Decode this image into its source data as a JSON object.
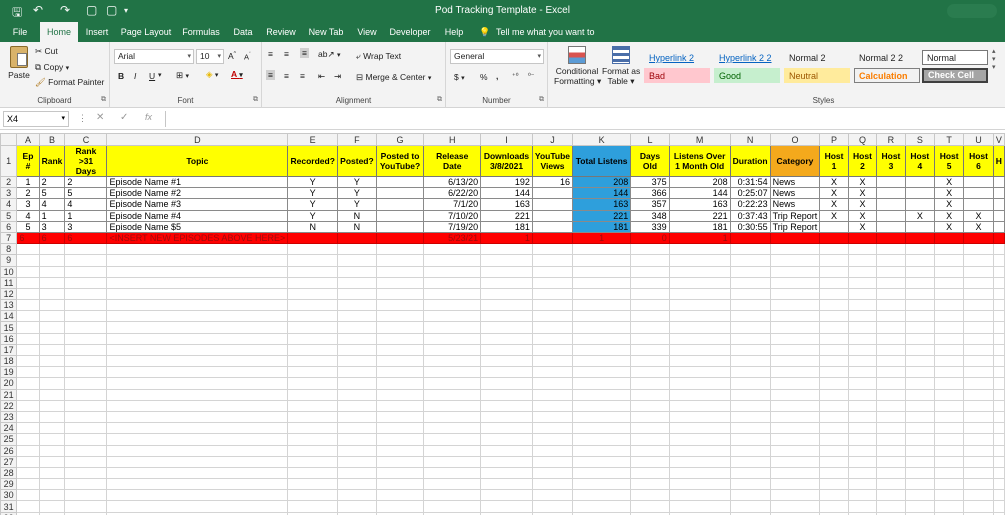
{
  "window": {
    "title": "Pod Tracking Template  -  Excel"
  },
  "tabs": [
    "File",
    "Home",
    "Insert",
    "Page Layout",
    "Formulas",
    "Data",
    "Review",
    "New Tab",
    "View",
    "Developer",
    "Help"
  ],
  "tell_me": "Tell me what you want to do",
  "ribbon": {
    "clipboard": {
      "paste": "Paste",
      "cut": "Cut",
      "copy": "Copy",
      "format_painter": "Format Painter",
      "label": "Clipboard"
    },
    "font": {
      "name": "Arial",
      "size": "10",
      "label": "Font",
      "bold": "B",
      "italic": "I",
      "underline": "U"
    },
    "alignment": {
      "wrap": "Wrap Text",
      "merge": "Merge & Center",
      "label": "Alignment"
    },
    "number": {
      "format": "General",
      "label": "Number",
      "currency": "$",
      "percent": "%",
      "comma": ","
    },
    "cond": {
      "conditional": "Conditional",
      "formatting": "Formatting",
      "format_as": "Format as",
      "table": "Table"
    },
    "styles": {
      "label": "Styles",
      "items": [
        {
          "text": "Hyperlink 2",
          "kind": "link"
        },
        {
          "text": "Hyperlink 2 2",
          "kind": "link"
        },
        {
          "text": "Normal 2",
          "kind": "normal"
        },
        {
          "text": "Normal 2 2",
          "kind": "normal"
        },
        {
          "text": "Normal",
          "kind": "boxed"
        },
        {
          "text": "Bad",
          "kind": "bad"
        },
        {
          "text": "Good",
          "kind": "good"
        },
        {
          "text": "Neutral",
          "kind": "neutral"
        },
        {
          "text": "Calculation",
          "kind": "calc"
        },
        {
          "text": "Check Cell",
          "kind": "check"
        }
      ]
    }
  },
  "formula_bar": {
    "name_box": "X4",
    "fx": "fx",
    "formula": ""
  },
  "columns": [
    "A",
    "B",
    "C",
    "D",
    "E",
    "F",
    "G",
    "H",
    "I",
    "J",
    "K",
    "L",
    "M",
    "N",
    "O",
    "P",
    "Q",
    "R",
    "S",
    "T",
    "U",
    "V"
  ],
  "header_row": [
    "Ep #",
    "Rank",
    "Rank >31 Days",
    "Topic",
    "Recorded?",
    "Posted?",
    "Posted to YouTube?",
    "Release Date",
    "Downloads 3/8/2021",
    "YouTube Views",
    "Total Listens",
    "Days Old",
    "Listens Over 1 Month Old",
    "Duration",
    "Category",
    "Host 1",
    "Host 2",
    "Host 3",
    "Host 4",
    "Host 5",
    "Host 6",
    "H"
  ],
  "rows": [
    [
      "1",
      "2",
      "2",
      "Episode Name #1",
      "Y",
      "Y",
      "",
      "6/13/20",
      "192",
      "16",
      "208",
      "375",
      "208",
      "0:31:54",
      "News",
      "X",
      "X",
      "",
      "",
      "X",
      "",
      ""
    ],
    [
      "2",
      "5",
      "5",
      "Episode Name #2",
      "Y",
      "Y",
      "",
      "6/22/20",
      "144",
      "",
      "144",
      "366",
      "144",
      "0:25:07",
      "News",
      "X",
      "X",
      "",
      "",
      "X",
      "",
      ""
    ],
    [
      "3",
      "4",
      "4",
      "Episode Name #3",
      "Y",
      "Y",
      "",
      "7/1/20",
      "163",
      "",
      "163",
      "357",
      "163",
      "0:22:23",
      "News",
      "X",
      "X",
      "",
      "",
      "X",
      "",
      ""
    ],
    [
      "4",
      "1",
      "1",
      "Episode Name #4",
      "Y",
      "N",
      "",
      "7/10/20",
      "221",
      "",
      "221",
      "348",
      "221",
      "0:37:43",
      "Trip Report",
      "X",
      "X",
      "",
      "X",
      "X",
      "X",
      ""
    ],
    [
      "5",
      "3",
      "3",
      "Episode Name $5",
      "N",
      "N",
      "",
      "7/19/20",
      "181",
      "",
      "181",
      "339",
      "181",
      "0:30:55",
      "Trip Report",
      "",
      "X",
      "",
      "",
      "X",
      "X",
      ""
    ]
  ],
  "insert_row": [
    "6",
    "6",
    "6",
    "<INSERT NEW EPISODES ABOVE HERE>",
    "",
    "",
    "",
    "5/23/21",
    "1",
    "",
    "1",
    "0",
    "1",
    "",
    "",
    "",
    "",
    "",
    "",
    "",
    "",
    ""
  ],
  "row_numbers": [
    "1",
    "2",
    "3",
    "4",
    "5",
    "6",
    "7",
    "8",
    "9",
    "10",
    "11",
    "12",
    "13",
    "14",
    "15",
    "16",
    "17",
    "18",
    "19",
    "20",
    "21",
    "22",
    "23",
    "24",
    "25",
    "26",
    "27",
    "28",
    "29",
    "30",
    "31",
    "32"
  ]
}
